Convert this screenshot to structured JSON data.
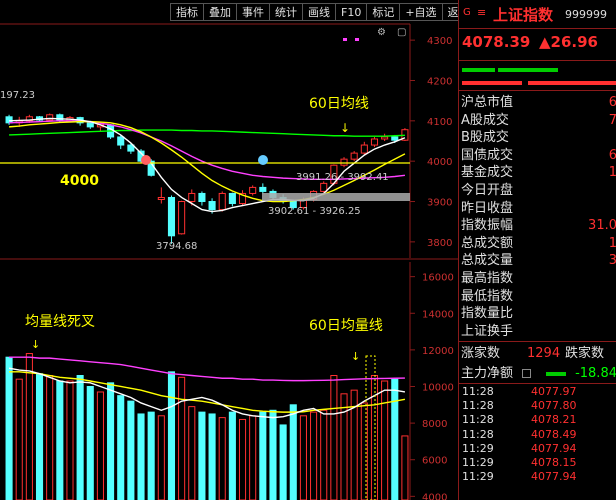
{
  "toolbar": {
    "buttons": [
      "指标",
      "叠加",
      "事件",
      "统计",
      "画线",
      "F10",
      "标记",
      "+自选",
      "返回"
    ]
  },
  "kline_panel": {
    "y_ticks": [
      "4300",
      "4200",
      "4100",
      "4000",
      "3900",
      "3800"
    ],
    "high_label": "197.23",
    "low_label": "3794.68",
    "level_label": "4000",
    "range_label_1": "3991.26 - 3992.41",
    "range_label_2": "3902.61 - 3926.25",
    "annotation": "60日均线"
  },
  "volume_panel": {
    "y_ticks": [
      "16000",
      "14000",
      "12000",
      "10000",
      "8000",
      "6000",
      "4000"
    ],
    "annotation_left": "均量线死叉",
    "annotation_right": "60日均量线"
  },
  "colors": {
    "up": "#ff3030",
    "down": "#54ffff",
    "ma5": "#ffffff",
    "ma10": "#ffff00",
    "ma20": "#ff40ff",
    "ma60": "#00ff00",
    "axis": "#8a1a1a"
  },
  "header": {
    "g_label": "G",
    "arrows": "≡",
    "name": "上证指数",
    "code": "999999"
  },
  "quote": {
    "price": "4078.39",
    "change": "▲26.96"
  },
  "stats": [
    {
      "label": "沪总市值",
      "value": "6"
    },
    {
      "label": "A股成交",
      "value": "7"
    },
    {
      "label": "B股成交",
      "value": ""
    },
    {
      "label": "国债成交",
      "value": "6"
    },
    {
      "label": "基金成交",
      "value": "1"
    },
    {
      "label": "今日开盘",
      "value": ""
    },
    {
      "label": "昨日收盘",
      "value": ""
    },
    {
      "label": "指数振幅",
      "value": "31.0"
    },
    {
      "label": "总成交额",
      "value": "1"
    },
    {
      "label": "总成交量",
      "value": "3"
    },
    {
      "label": "最高指数",
      "value": ""
    },
    {
      "label": "最低指数",
      "value": ""
    },
    {
      "label": "指数量比",
      "value": ""
    },
    {
      "label": "上证换手",
      "value": ""
    }
  ],
  "advance": {
    "label": "涨家数",
    "value": "1294",
    "label2": "跌家数"
  },
  "main_flow": {
    "label": "主力净额",
    "value": "-18.84"
  },
  "ticks": [
    {
      "time": "11:28",
      "price": "4077.97"
    },
    {
      "time": "11:28",
      "price": "4077.80"
    },
    {
      "time": "11:28",
      "price": "4078.21"
    },
    {
      "time": "11:28",
      "price": "4078.49"
    },
    {
      "time": "11:29",
      "price": "4077.94"
    },
    {
      "time": "11:29",
      "price": "4078.15"
    },
    {
      "time": "11:29",
      "price": "4077.94"
    }
  ],
  "chart_data": [
    {
      "type": "candlestick",
      "title": "",
      "ylim": [
        3760,
        4340
      ],
      "yticks": [
        4300,
        4200,
        4100,
        4000,
        3900,
        3800
      ],
      "candles": [
        {
          "o": 4110,
          "c": 4095,
          "h": 4115,
          "l": 4090
        },
        {
          "o": 4095,
          "c": 4100,
          "h": 4110,
          "l": 4085
        },
        {
          "o": 4100,
          "c": 4110,
          "h": 4115,
          "l": 4095
        },
        {
          "o": 4110,
          "c": 4102,
          "h": 4112,
          "l": 4098
        },
        {
          "o": 4102,
          "c": 4115,
          "h": 4118,
          "l": 4100
        },
        {
          "o": 4115,
          "c": 4100,
          "h": 4118,
          "l": 4096
        },
        {
          "o": 4100,
          "c": 4108,
          "h": 4112,
          "l": 4097
        },
        {
          "o": 4108,
          "c": 4095,
          "h": 4110,
          "l": 4088
        },
        {
          "o": 4095,
          "c": 4085,
          "h": 4100,
          "l": 4080
        },
        {
          "o": 4085,
          "c": 4090,
          "h": 4095,
          "l": 4075
        },
        {
          "o": 4090,
          "c": 4060,
          "h": 4092,
          "l": 4055
        },
        {
          "o": 4060,
          "c": 4040,
          "h": 4065,
          "l": 4030
        },
        {
          "o": 4040,
          "c": 4025,
          "h": 4045,
          "l": 4018
        },
        {
          "o": 4025,
          "c": 4000,
          "h": 4030,
          "l": 3995
        },
        {
          "o": 4000,
          "c": 3965,
          "h": 4005,
          "l": 3962
        },
        {
          "o": 3905,
          "c": 3910,
          "h": 3935,
          "l": 3895
        },
        {
          "o": 3910,
          "c": 3815,
          "h": 3915,
          "l": 3795
        },
        {
          "o": 3820,
          "c": 3900,
          "h": 3902,
          "l": 3818
        },
        {
          "o": 3900,
          "c": 3920,
          "h": 3930,
          "l": 3890
        },
        {
          "o": 3920,
          "c": 3900,
          "h": 3925,
          "l": 3890
        },
        {
          "o": 3900,
          "c": 3880,
          "h": 3908,
          "l": 3870
        },
        {
          "o": 3880,
          "c": 3920,
          "h": 3925,
          "l": 3875
        },
        {
          "o": 3920,
          "c": 3895,
          "h": 3922,
          "l": 3888
        },
        {
          "o": 3895,
          "c": 3920,
          "h": 3928,
          "l": 3890
        },
        {
          "o": 3920,
          "c": 3935,
          "h": 3940,
          "l": 3915
        },
        {
          "o": 3935,
          "c": 3925,
          "h": 3945,
          "l": 3920
        },
        {
          "o": 3925,
          "c": 3910,
          "h": 3930,
          "l": 3905
        },
        {
          "o": 3910,
          "c": 3900,
          "h": 3918,
          "l": 3895
        },
        {
          "o": 3900,
          "c": 3885,
          "h": 3905,
          "l": 3880
        },
        {
          "o": 3885,
          "c": 3905,
          "h": 3910,
          "l": 3880
        },
        {
          "o": 3905,
          "c": 3925,
          "h": 3928,
          "l": 3900
        },
        {
          "o": 3925,
          "c": 3945,
          "h": 3950,
          "l": 3922
        },
        {
          "o": 3945,
          "c": 3990,
          "h": 3992,
          "l": 3940
        },
        {
          "o": 3990,
          "c": 4005,
          "h": 4010,
          "l": 3985
        },
        {
          "o": 4005,
          "c": 4020,
          "h": 4025,
          "l": 4000
        },
        {
          "o": 4020,
          "c": 4040,
          "h": 4048,
          "l": 4015
        },
        {
          "o": 4040,
          "c": 4055,
          "h": 4060,
          "l": 4035
        },
        {
          "o": 4055,
          "c": 4060,
          "h": 4068,
          "l": 4050
        },
        {
          "o": 4060,
          "c": 4052,
          "h": 4065,
          "l": 4045
        },
        {
          "o": 4052,
          "c": 4078,
          "h": 4082,
          "l": 4050
        }
      ],
      "ma5": [
        4100,
        4101,
        4102,
        4104,
        4106,
        4105,
        4104,
        4102,
        4098,
        4090,
        4080,
        4065,
        4045,
        4020,
        3995,
        3960,
        3930,
        3910,
        3895,
        3880,
        3875,
        3878,
        3885,
        3890,
        3895,
        3900,
        3905,
        3905,
        3903,
        3902,
        3908,
        3920,
        3945,
        3975,
        3995,
        4015,
        4030,
        4040,
        4048,
        4058
      ],
      "ma10": [
        4085,
        4087,
        4090,
        4092,
        4094,
        4096,
        4097,
        4098,
        4098,
        4097,
        4095,
        4090,
        4083,
        4073,
        4060,
        4045,
        4028,
        4010,
        3990,
        3970,
        3952,
        3938,
        3926,
        3916,
        3908,
        3902,
        3900,
        3900,
        3902,
        3905,
        3910,
        3918,
        3928,
        3940,
        3952,
        3965,
        3978,
        3992,
        4005,
        4018
      ],
      "ma20": [
        4095,
        4096,
        4097,
        4098,
        4099,
        4100,
        4100,
        4099,
        4097,
        4094,
        4090,
        4085,
        4078,
        4070,
        4060,
        4050,
        4038,
        4025,
        4012,
        4000,
        3990,
        3982,
        3975,
        3970,
        3965,
        3962,
        3960,
        3958,
        3957,
        3956,
        3955,
        3955,
        3955,
        3956,
        3957,
        3958,
        3959,
        3960,
        3962,
        3965
      ],
      "ma60": [
        4065,
        4066,
        4067,
        4068,
        4069,
        4070,
        4071,
        4072,
        4073,
        4074,
        4075,
        4076,
        4076,
        4077,
        4077,
        4077,
        4077,
        4076,
        4076,
        4075,
        4075,
        4074,
        4073,
        4072,
        4071,
        4070,
        4069,
        4068,
        4067,
        4066,
        4065,
        4064,
        4063,
        4063,
        4062,
        4062,
        4062,
        4062,
        4063,
        4064
      ]
    },
    {
      "type": "bar",
      "title": "",
      "ylim": [
        3800,
        16800
      ],
      "yticks": [
        16000,
        14000,
        12000,
        10000,
        8000,
        6000,
        4000
      ],
      "volumes": [
        11600,
        10400,
        11800,
        10700,
        10600,
        10300,
        10300,
        10600,
        10000,
        9700,
        10200,
        9500,
        9200,
        8500,
        8600,
        8400,
        10800,
        10500,
        8900,
        8600,
        8500,
        8300,
        8600,
        8200,
        8400,
        8600,
        8700,
        7900,
        9000,
        8400,
        8600,
        8700,
        10600,
        9600,
        9800,
        9100,
        10600,
        10300,
        10400,
        7300
      ],
      "ma5": [
        11000,
        10900,
        10850,
        10700,
        10500,
        10300,
        10200,
        10250,
        10200,
        10000,
        9800,
        9600,
        9400,
        9100,
        8900,
        8700,
        8900,
        9200,
        9300,
        9400,
        9250,
        9000,
        8700,
        8500,
        8400,
        8350,
        8300,
        8350,
        8500,
        8700,
        8800,
        8500,
        8500,
        8600,
        8850,
        9200,
        9500,
        9800,
        9800,
        9700
      ],
      "ma10": [
        10800,
        10800,
        10750,
        10700,
        10600,
        10500,
        10450,
        10400,
        10300,
        10200,
        10100,
        10000,
        9900,
        9800,
        9650,
        9500,
        9400,
        9300,
        9250,
        9200,
        9100,
        9000,
        8900,
        8800,
        8700,
        8650,
        8620,
        8600,
        8600,
        8620,
        8700,
        8750,
        8800,
        8850,
        8900,
        8950,
        9000,
        9100,
        9200,
        9300
      ],
      "ma20": [
        11600,
        11600,
        11600,
        11550,
        11550,
        11500,
        11450,
        11400,
        11350,
        11300,
        11250,
        11200,
        11100,
        11000,
        10900,
        10800,
        10700,
        10650,
        10600,
        10550,
        10500,
        10450,
        10450,
        10400,
        10400,
        10350,
        10350,
        10330,
        10320,
        10320,
        10330,
        10340,
        10350,
        10380,
        10400,
        10420,
        10430,
        10440,
        10450,
        10460
      ]
    }
  ]
}
